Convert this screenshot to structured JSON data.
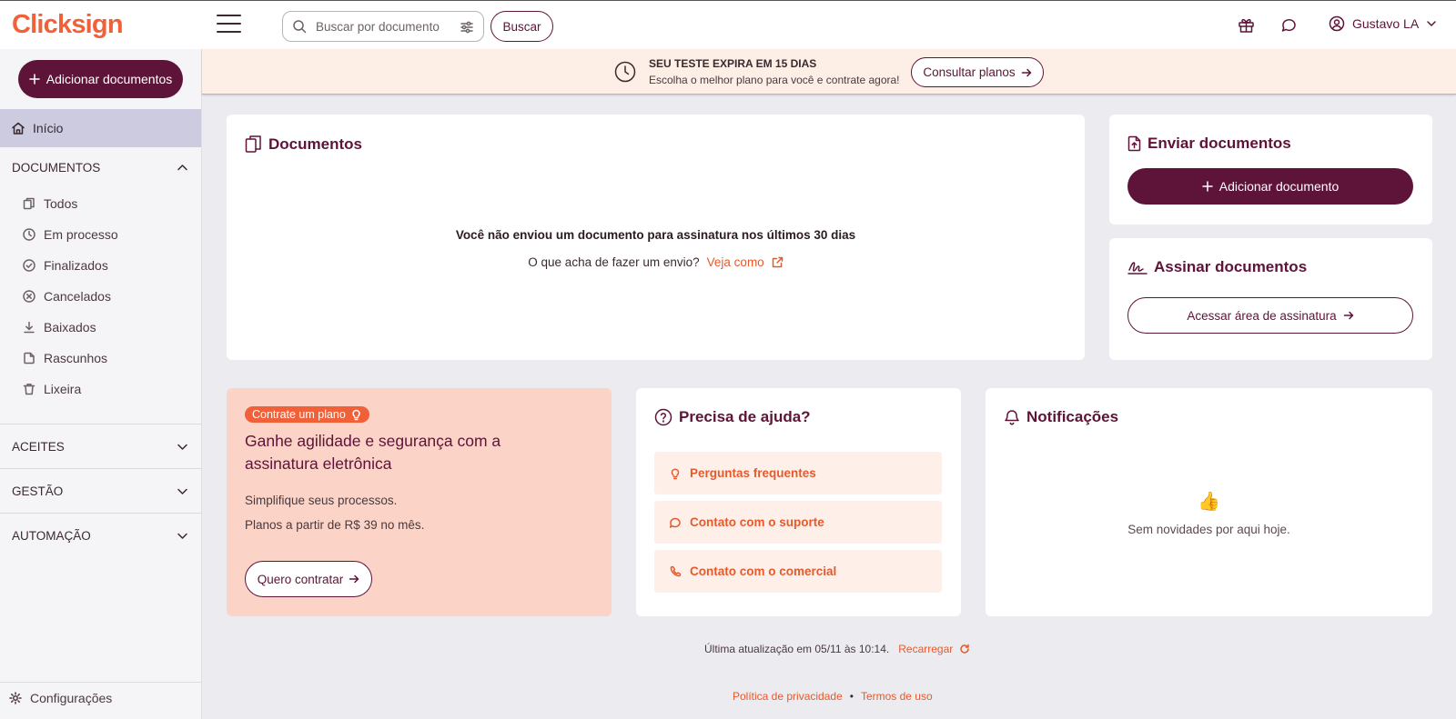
{
  "app": {
    "logo_text": "Clicksign",
    "brand_color": "#f0613a",
    "primary_color": "#5e1338"
  },
  "header": {
    "search_placeholder": "Buscar por documento",
    "search_button": "Buscar",
    "user_name": "Gustavo LA",
    "icons": [
      "menu-icon",
      "search-icon",
      "filter-icon",
      "gift-icon",
      "chat-icon",
      "user-icon",
      "chevron-down-icon"
    ]
  },
  "banner": {
    "title": "SEU TESTE EXPIRA EM 15 DIAS",
    "subtitle": "Escolha o melhor plano para você e contrate agora!",
    "button": "Consultar planos"
  },
  "sidebar": {
    "add_button": "Adicionar documentos",
    "home": "Início",
    "documents_section": "DOCUMENTOS",
    "documents_items": [
      {
        "label": "Todos",
        "icon": "copy-icon"
      },
      {
        "label": "Em processo",
        "icon": "clock-icon"
      },
      {
        "label": "Finalizados",
        "icon": "check-circle-icon"
      },
      {
        "label": "Cancelados",
        "icon": "x-circle-icon"
      },
      {
        "label": "Baixados",
        "icon": "download-icon"
      },
      {
        "label": "Rascunhos",
        "icon": "draft-icon"
      },
      {
        "label": "Lixeira",
        "icon": "trash-icon"
      }
    ],
    "sections": [
      "ACEITES",
      "GESTÃO",
      "AUTOMAÇÃO"
    ],
    "settings": "Configurações"
  },
  "documents_card": {
    "title": "Documentos",
    "empty_message": "Você não enviou um documento para assinatura nos últimos 30 dias",
    "prompt": "O que acha de fazer um envio?",
    "link": "Veja como"
  },
  "send_card": {
    "title": "Enviar documentos",
    "button": "Adicionar documento"
  },
  "sign_card": {
    "title": "Assinar documentos",
    "button": "Acessar área de assinatura"
  },
  "promo_card": {
    "badge": "Contrate um plano",
    "headline": "Ganhe agilidade e segurança com a assinatura eletrônica",
    "line1": "Simplifique seus processos.",
    "line2": "Planos a partir de R$ 39 no mês.",
    "button": "Quero contratar"
  },
  "help_card": {
    "title": "Precisa de ajuda?",
    "items": [
      {
        "label": "Perguntas frequentes",
        "icon": "lightbulb-icon"
      },
      {
        "label": "Contato com o suporte",
        "icon": "chat-icon"
      },
      {
        "label": "Contato com o comercial",
        "icon": "phone-icon"
      }
    ]
  },
  "notifications_card": {
    "title": "Notificações",
    "emoji": "👍",
    "empty": "Sem novidades por aqui hoje."
  },
  "footer": {
    "last_update": "Última atualização em 05/11 às 10:14.",
    "reload": "Recarregar",
    "privacy": "Política de privacidade",
    "separator": "•",
    "terms": "Termos de uso"
  }
}
